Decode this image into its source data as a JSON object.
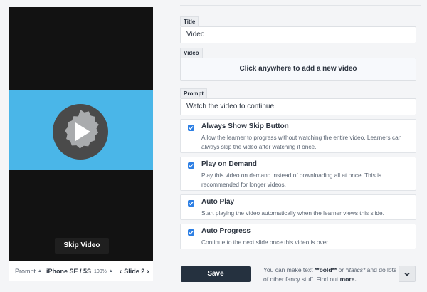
{
  "preview": {
    "skip_button_label": "Skip Video",
    "device_bar": {
      "prompt_label": "Prompt",
      "device_name": "iPhone SE / 5S",
      "zoom_level": "100%",
      "slide_label": "Slide 2"
    },
    "colors": {
      "video_band": "#4ab6e8",
      "screen": "#121212"
    },
    "icons": [
      "play-icon",
      "caret-up-icon",
      "chevron-left-icon",
      "chevron-right-icon"
    ]
  },
  "form": {
    "title_label": "Title",
    "title_value": "Video",
    "video_label": "Video",
    "video_dropzone": "Click anywhere to add a new video",
    "prompt_label": "Prompt",
    "prompt_value": "Watch the video to continue",
    "options": [
      {
        "title": "Always Show Skip Button",
        "desc": "Allow the learner to progress without watching the entire video. Learners can always skip the video after watching it once.",
        "checked": true
      },
      {
        "title": "Play on Demand",
        "desc": "Play this video on demand instead of downloading all at once. This is recommended for longer videos.",
        "checked": true
      },
      {
        "title": "Auto Play",
        "desc": "Start playing the video automatically when the learner views this slide.",
        "checked": true
      },
      {
        "title": "Auto Progress",
        "desc": "Continue to the next slide once this video is over.",
        "checked": true
      }
    ]
  },
  "footer": {
    "save_label": "Save",
    "help_prefix": "You can make text ",
    "help_bold": "**bold**",
    "help_or": " or ",
    "help_italics": "*italics*",
    "help_suffix": " and do lots of other fancy stuff. Find out ",
    "help_link": "more.",
    "expand_icon": "chevron-down-icon"
  },
  "colors": {
    "accent": "#2d7fe4",
    "save_button": "#25313f"
  }
}
